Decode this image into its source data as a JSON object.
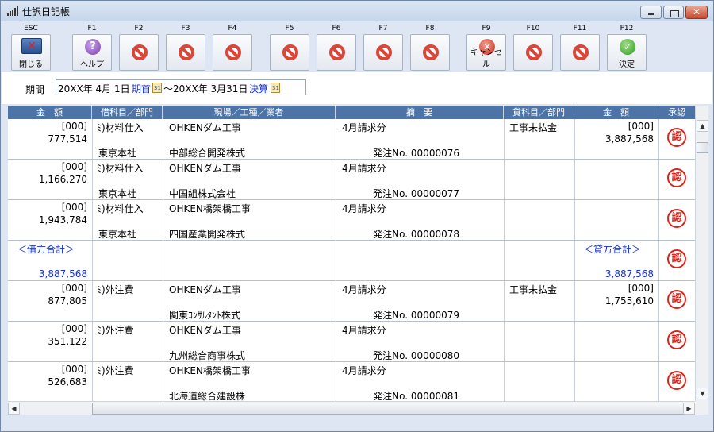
{
  "window": {
    "title": "仕訳日記帳"
  },
  "toolbar": {
    "keys": [
      {
        "key": "ESC",
        "label": "閉じる",
        "icon": "exit-icon"
      },
      {
        "key": "F1",
        "label": "ヘルプ",
        "icon": "help-icon"
      },
      {
        "key": "F2",
        "label": "",
        "icon": "disabled-icon"
      },
      {
        "key": "F3",
        "label": "",
        "icon": "disabled-icon"
      },
      {
        "key": "F4",
        "label": "",
        "icon": "disabled-icon"
      },
      {
        "key": "F5",
        "label": "",
        "icon": "disabled-icon"
      },
      {
        "key": "F6",
        "label": "",
        "icon": "disabled-icon"
      },
      {
        "key": "F7",
        "label": "",
        "icon": "disabled-icon"
      },
      {
        "key": "F8",
        "label": "",
        "icon": "disabled-icon"
      },
      {
        "key": "F9",
        "label": "キャンセル",
        "icon": "cancel-icon"
      },
      {
        "key": "F10",
        "label": "",
        "icon": "disabled-icon"
      },
      {
        "key": "F11",
        "label": "",
        "icon": "disabled-icon"
      },
      {
        "key": "F12",
        "label": "決定",
        "icon": "check-icon"
      }
    ]
  },
  "period": {
    "label": "期間",
    "start": "20XX年 4月 1日",
    "start_link": "期首",
    "separator": "～20XX年 3月31日",
    "end_link": "決算"
  },
  "table": {
    "headers": [
      "金　額",
      "借科目／部門",
      "現場／工種／業者",
      "摘　要",
      "貸科目／部門",
      "金　額",
      "承認"
    ],
    "rows": [
      {
        "d_code": "[000]",
        "d_amount": "777,514",
        "d_acct": "ﾐ)材料仕入",
        "d_dept": "東京本社",
        "site": "OHKENダム工事",
        "vendor": "中部総合開発株式",
        "memo": "4月請求分",
        "order": "発注No. 00000076",
        "c_acct": "工事未払金",
        "c_code": "[000]",
        "c_amount": "3,887,568",
        "stamp": "認"
      },
      {
        "d_code": "[000]",
        "d_amount": "1,166,270",
        "d_acct": "ﾐ)材料仕入",
        "d_dept": "東京本社",
        "site": "OHKENダム工事",
        "vendor": "中国組株式会社",
        "memo": "4月請求分",
        "order": "発注No. 00000077",
        "c_acct": "",
        "c_code": "",
        "c_amount": "",
        "stamp": "認"
      },
      {
        "d_code": "[000]",
        "d_amount": "1,943,784",
        "d_acct": "ﾐ)材料仕入",
        "d_dept": "東京本社",
        "site": "OHKEN橋架橋工事",
        "vendor": "四国産業開発株式",
        "memo": "4月請求分",
        "order": "発注No. 00000078",
        "c_acct": "",
        "c_code": "",
        "c_amount": "",
        "stamp": "認"
      },
      {
        "total": true,
        "d_label": "＜借方合計＞",
        "d_total": "3,887,568",
        "c_label": "＜貸方合計＞",
        "c_total": "3,887,568",
        "stamp": "認"
      },
      {
        "d_code": "[000]",
        "d_amount": "877,805",
        "d_acct": "ﾐ)外注費",
        "d_dept": "",
        "site": "OHKENダム工事",
        "vendor": "関東ｺﾝｻﾙﾀﾝﾄ株式",
        "memo": "4月請求分",
        "order": "発注No. 00000079",
        "c_acct": "工事未払金",
        "c_code": "[000]",
        "c_amount": "1,755,610",
        "stamp": "認"
      },
      {
        "d_code": "[000]",
        "d_amount": "351,122",
        "d_acct": "ﾐ)外注費",
        "d_dept": "",
        "site": "OHKENダム工事",
        "vendor": "九州総合商事株式",
        "memo": "4月請求分",
        "order": "発注No. 00000080",
        "c_acct": "",
        "c_code": "",
        "c_amount": "",
        "stamp": "認"
      },
      {
        "d_code": "[000]",
        "d_amount": "526,683",
        "d_acct": "ﾐ)外注費",
        "d_dept": "",
        "site": "OHKEN橋架橋工事",
        "vendor": "北海道総合建設株",
        "memo": "4月請求分",
        "order": "発注No. 00000081",
        "c_acct": "",
        "c_code": "",
        "c_amount": "",
        "stamp": "認"
      }
    ]
  },
  "colors": {
    "header_bg": "#4c74a8",
    "link_blue": "#1430d8",
    "stamp_red": "#d8251c"
  }
}
